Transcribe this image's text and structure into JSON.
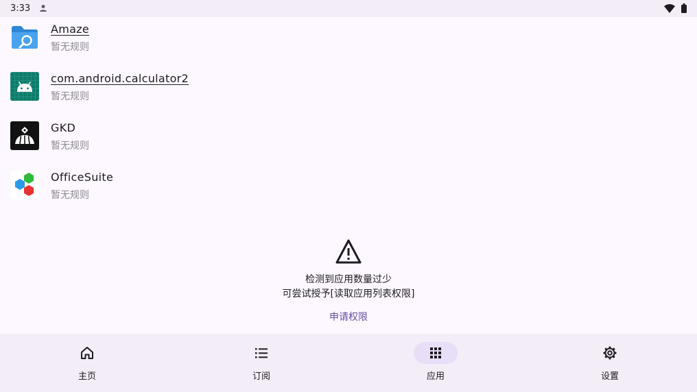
{
  "status_bar": {
    "time": "3:33"
  },
  "apps": [
    {
      "name": "Amaze",
      "subtitle": "暂无规则",
      "icon": "amaze-folder-icon"
    },
    {
      "name": "com.android.calculator2",
      "subtitle": "暂无规则",
      "icon": "android-robot-icon"
    },
    {
      "name": "GKD",
      "subtitle": "暂无规则",
      "icon": "gkd-app-icon"
    },
    {
      "name": "OfficeSuite",
      "subtitle": "暂无规则",
      "icon": "officesuite-hexagon-icon"
    }
  ],
  "warning": {
    "icon": "warning-triangle-icon",
    "line1": "检测到应用数量过少",
    "line2": "可尝试授予[读取应用列表权限]",
    "action": "申请权限"
  },
  "nav": [
    {
      "label": "主页",
      "icon": "home-icon",
      "active": false
    },
    {
      "label": "订阅",
      "icon": "list-icon",
      "active": false
    },
    {
      "label": "应用",
      "icon": "grid-icon",
      "active": true
    },
    {
      "label": "设置",
      "icon": "gear-icon",
      "active": false
    }
  ],
  "colors": {
    "background": "#fdf7ff",
    "surface": "#f3edf7",
    "accent": "#6750a4",
    "active_pill": "#e8def8",
    "subtitle": "#8c8a92"
  }
}
